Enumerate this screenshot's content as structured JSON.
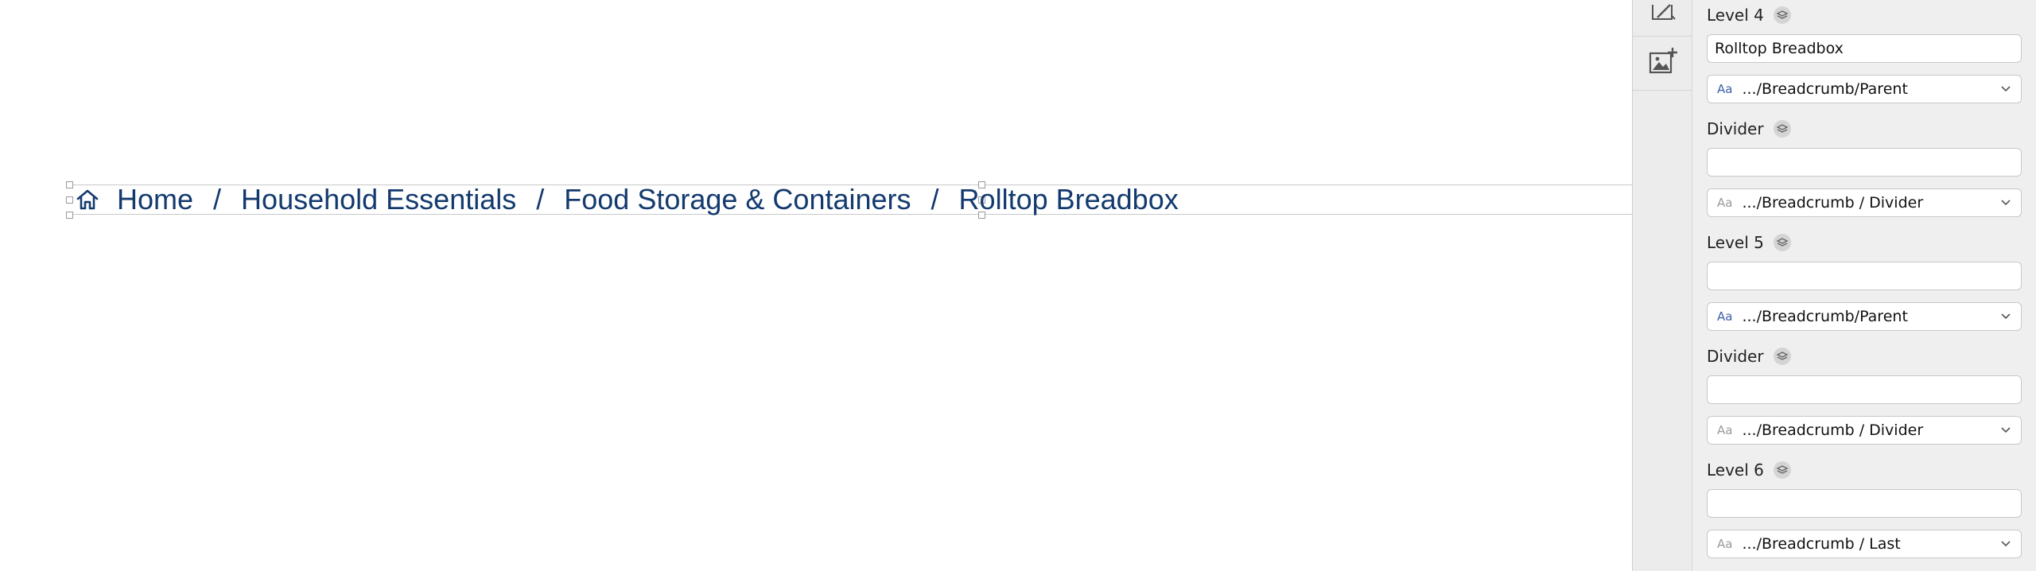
{
  "breadcrumb": {
    "items": [
      "Home",
      "Household Essentials",
      "Food Storage & Containers",
      "Rolltop Breadbox"
    ],
    "separator": "/",
    "color": "#133a6e"
  },
  "toolbar": {
    "tools": [
      {
        "icon": "edit-image-icon"
      },
      {
        "icon": "add-image-icon"
      }
    ]
  },
  "panel": {
    "rows": [
      {
        "label": "Level 4",
        "value": "Rolltop Breadbox",
        "style_prefix": "Aa",
        "style": ".../Breadcrumb/Parent"
      },
      {
        "label": "Divider",
        "value": "",
        "style_prefix": "Aa",
        "style": ".../Breadcrumb / Divider"
      },
      {
        "label": "Level 5",
        "value": "",
        "style_prefix": "Aa",
        "style": ".../Breadcrumb/Parent"
      },
      {
        "label": "Divider",
        "value": "",
        "style_prefix": "Aa",
        "style": ".../Breadcrumb / Divider"
      },
      {
        "label": "Level 6",
        "value": "",
        "style_prefix": "Aa",
        "style": ".../Breadcrumb / Last"
      }
    ]
  }
}
